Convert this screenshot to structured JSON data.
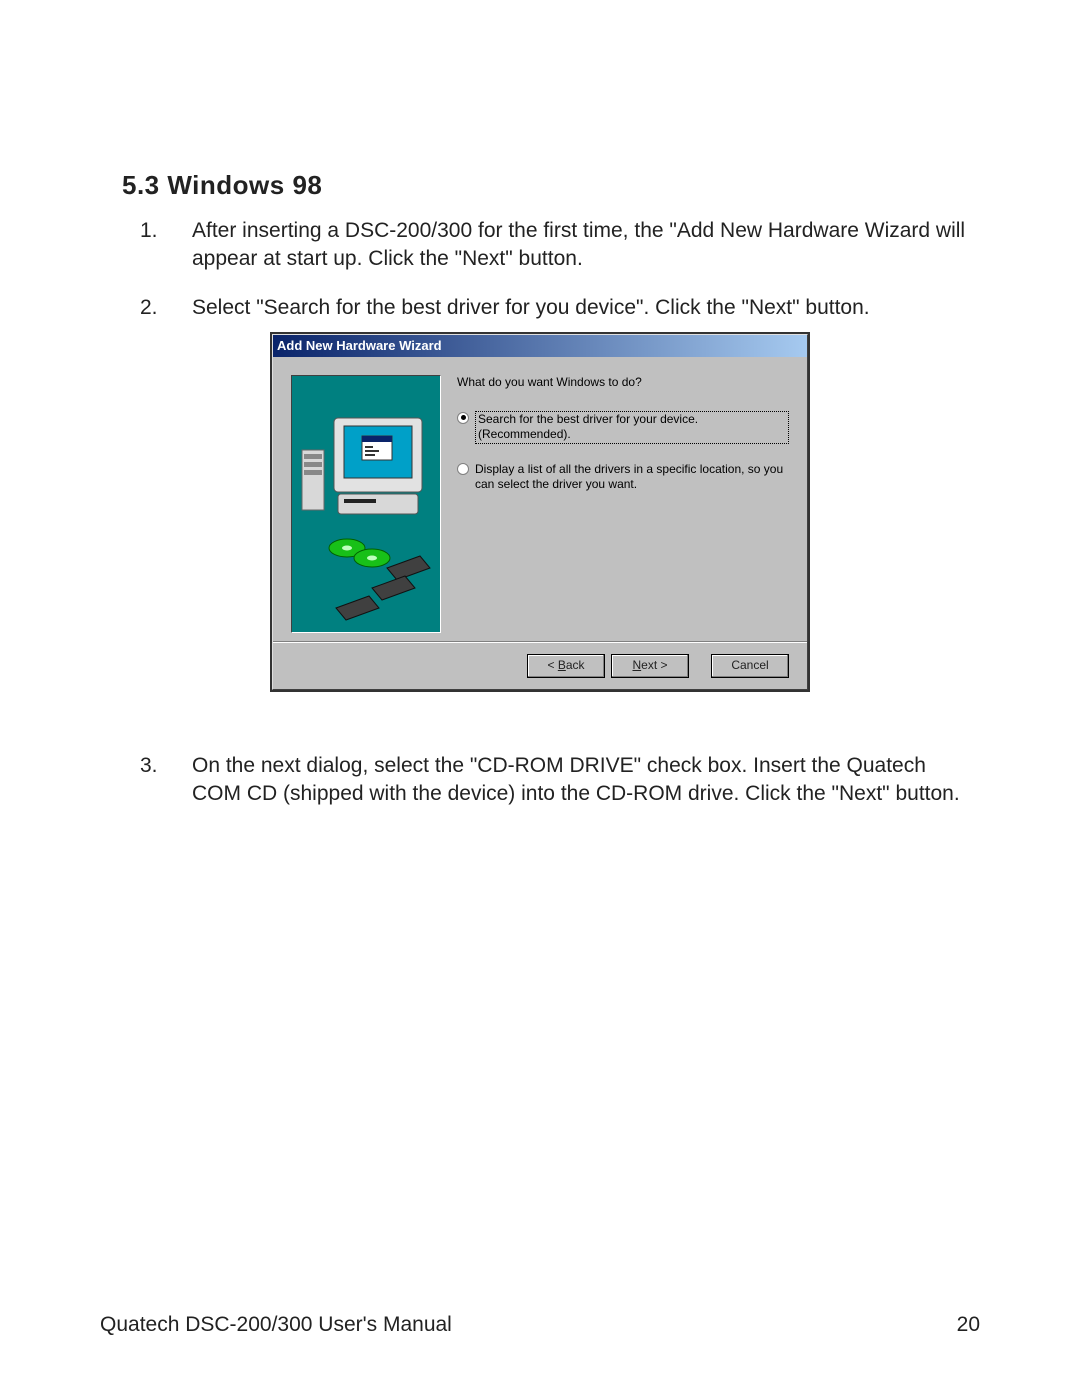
{
  "heading": "5.3  Windows 98",
  "items": [
    {
      "num": "1.",
      "text": "After inserting a DSC-200/300 for the first time, the \"Add New Hardware Wizard will appear at start up. Click the \"Next\" button."
    },
    {
      "num": "2.",
      "text": "Select \"Search for the best driver for you device\". Click the \"Next\" button."
    },
    {
      "num": "3.",
      "text": "On the next dialog, select the \"CD-ROM DRIVE\" check box. Insert the Quatech COM CD (shipped with the device) into the CD-ROM drive. Click the \"Next\" button."
    }
  ],
  "wizard": {
    "title": "Add New Hardware Wizard",
    "prompt": "What do you want Windows to do?",
    "option1": "Search for the best driver for your device. (Recommended).",
    "option2": "Display a list of all the drivers in a specific location, so you can select the driver you want.",
    "back_prefix": "< ",
    "back_u": "B",
    "back_suffix": "ack",
    "next_prefix": "",
    "next_u": "N",
    "next_suffix": "ext >",
    "cancel": "Cancel"
  },
  "footer_left": "Quatech   DSC-200/300 User's Manual",
  "footer_right": "20"
}
